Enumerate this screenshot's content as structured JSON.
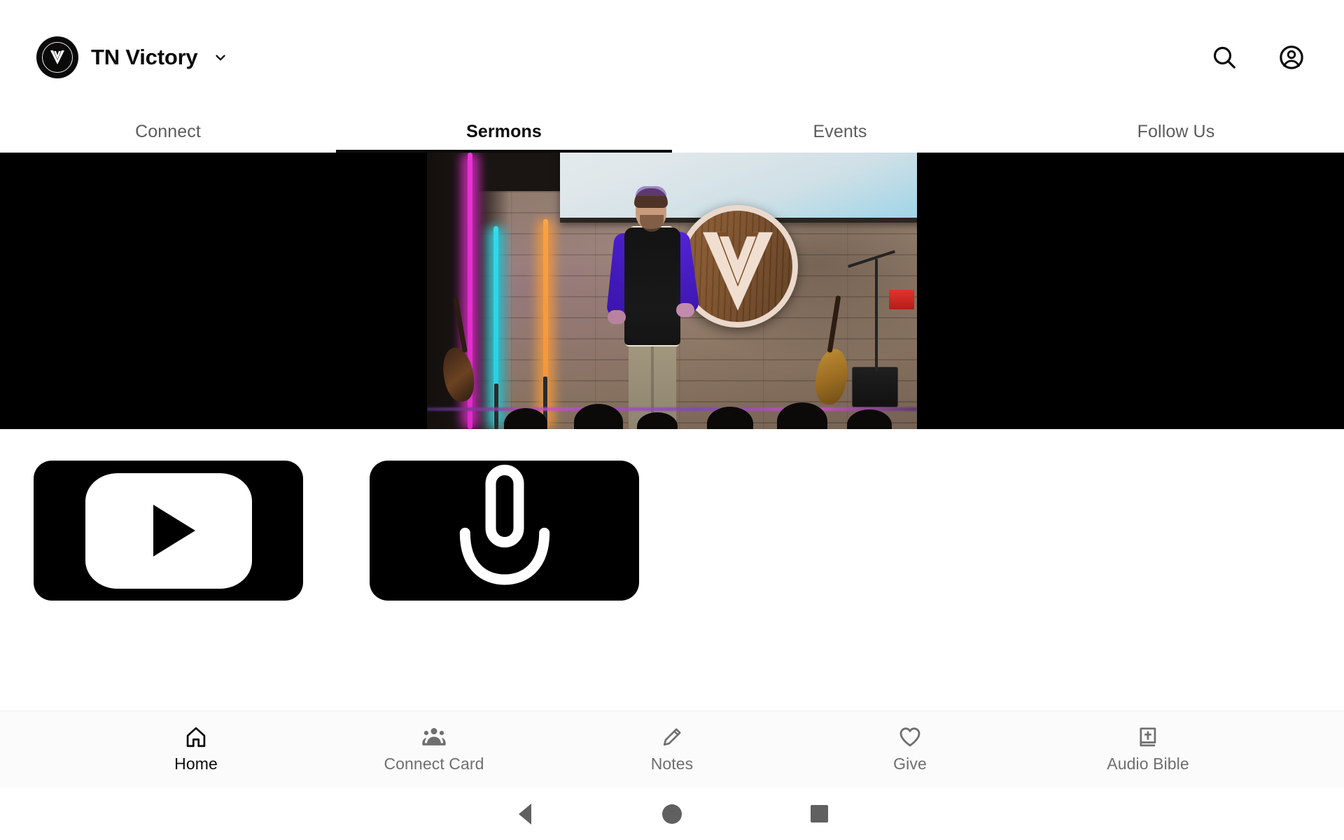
{
  "appbar": {
    "brand_name": "TN Victory",
    "brand_logo_icon": "victory-chevron-logo",
    "chevron_icon": "chevron-down-icon",
    "search_icon": "search-icon",
    "account_icon": "account-circle-icon"
  },
  "tabs": [
    {
      "label": "Connect",
      "active": false
    },
    {
      "label": "Sermons",
      "active": true
    },
    {
      "label": "Events",
      "active": false
    },
    {
      "label": "Follow Us",
      "active": false
    }
  ],
  "hero": {
    "type": "video-player",
    "description": "Sermon video: speaker on stage in front of wooden plank wall with circular Victory chevron logo, LED light tubes, projection screen, guitars and amplifier",
    "letterbox_color": "#000000"
  },
  "cards": [
    {
      "label": "YouTube",
      "icon": "youtube-play-icon",
      "background": "#000000"
    },
    {
      "label": "Podcast",
      "icon": "microphone-icon",
      "background": "#000000"
    }
  ],
  "bottom_nav": [
    {
      "label": "Home",
      "icon": "home-icon",
      "active": true
    },
    {
      "label": "Connect Card",
      "icon": "people-group-icon",
      "active": false
    },
    {
      "label": "Notes",
      "icon": "pencil-icon",
      "active": false
    },
    {
      "label": "Give",
      "icon": "heart-outline-icon",
      "active": false
    },
    {
      "label": "Audio Bible",
      "icon": "bible-book-cross-icon",
      "active": false
    }
  ],
  "system_nav": [
    {
      "name": "back",
      "icon": "triangle-back-icon"
    },
    {
      "name": "home",
      "icon": "circle-home-icon"
    },
    {
      "name": "recents",
      "icon": "square-recents-icon"
    }
  ],
  "colors": {
    "active_text": "#0b0b0b",
    "inactive_text": "#5c5c5c",
    "nav_inactive": "#6f6f6f",
    "background": "#ffffff",
    "card_background": "#000000",
    "system_icon": "#606060"
  }
}
